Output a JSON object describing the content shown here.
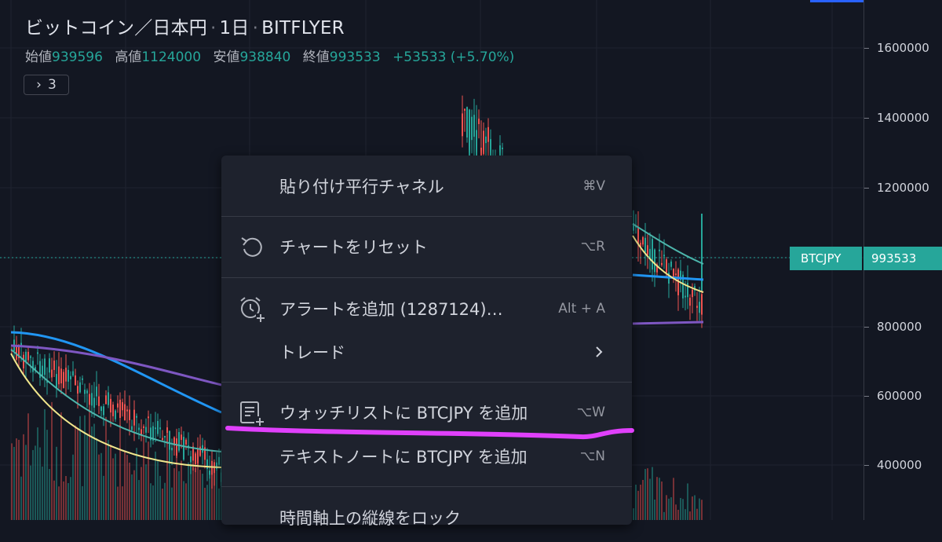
{
  "legend": {
    "symbol_name": "ビットコイン／日本円",
    "interval": "1日",
    "exchange": "BITFLYER",
    "open_label": "始値",
    "open_value": "939596",
    "high_label": "高値",
    "high_value": "1124000",
    "low_label": "安値",
    "low_value": "938840",
    "close_label": "終値",
    "close_value": "993533",
    "change": "+53533 (+5.70%)",
    "indicator_toggle_count": "3"
  },
  "price_axis": {
    "labels": [
      "1600000",
      "1400000",
      "1200000",
      "800000",
      "600000",
      "400000"
    ],
    "last_price": "993533",
    "symbol_tag": "BTCJPY"
  },
  "context_menu": {
    "items": [
      {
        "label": "貼り付け平行チャネル",
        "shortcut": "⌘V",
        "icon": ""
      },
      {
        "label": "チャートをリセット",
        "shortcut": "⌥R",
        "icon": "reset-icon"
      },
      {
        "label": "アラートを追加 (1287124)…",
        "shortcut": "Alt + A",
        "icon": "alarm-clock-add-icon"
      },
      {
        "label": "トレード",
        "shortcut": "",
        "icon": ""
      },
      {
        "label": "ウォッチリストに BTCJPY を追加",
        "shortcut": "⌥W",
        "icon": "watchlist-add-icon"
      },
      {
        "label": "テキストノートに BTCJPY を追加",
        "shortcut": "⌥N",
        "icon": ""
      },
      {
        "label": "時間軸上の縦線をロック",
        "shortcut": "",
        "icon": ""
      }
    ]
  },
  "colors": {
    "background": "#131722",
    "up": "#26a69a",
    "down": "#ef5350",
    "ma_blue": "#2196f3",
    "ma_purple": "#7e57c2",
    "ma_yellow": "#f0e68c",
    "ma_teal": "#4db6ac",
    "annotation": "#e040fb"
  }
}
